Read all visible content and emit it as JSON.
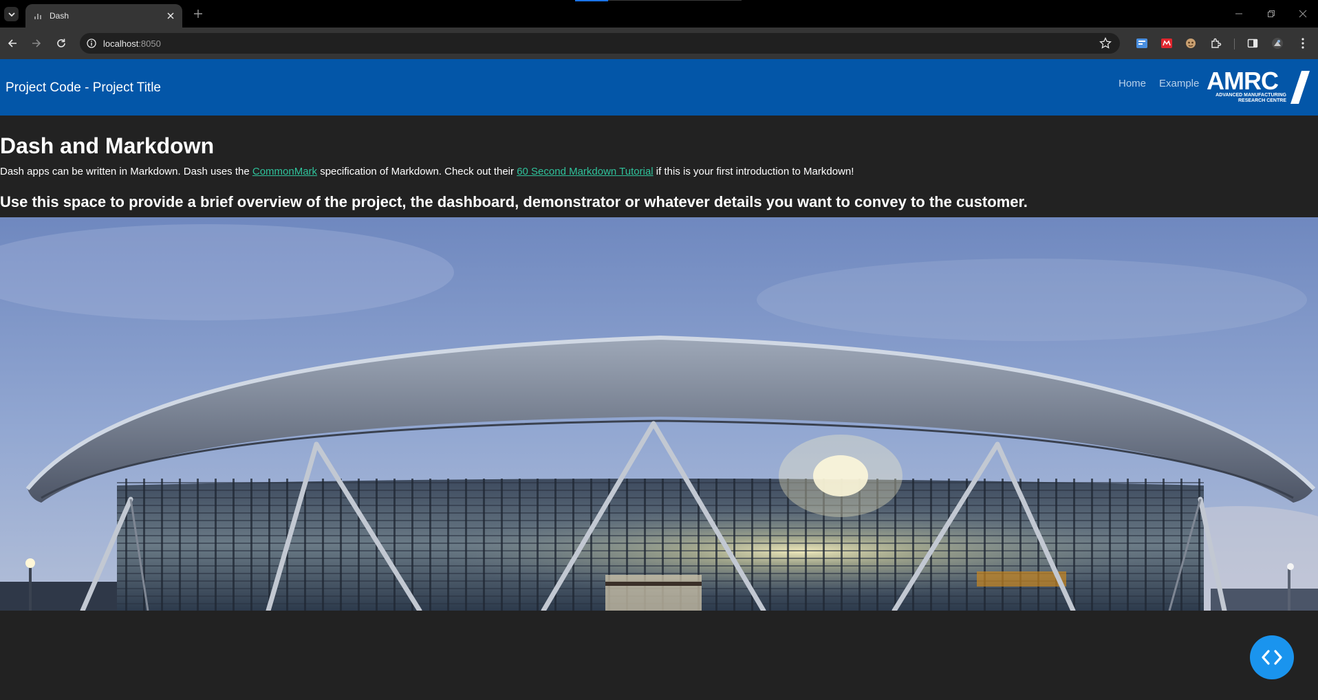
{
  "browser": {
    "tab_title": "Dash",
    "url_host": "localhost",
    "url_port": ":8050"
  },
  "app": {
    "brand": "Project Code - Project Title",
    "nav": [
      {
        "label": "Home"
      },
      {
        "label": "Example"
      }
    ],
    "logo": {
      "name": "AMRC",
      "line1": "ADVANCED MANUFACTURING",
      "line2": "RESEARCH CENTRE"
    }
  },
  "content": {
    "heading": "Dash and Markdown",
    "para_part1": "Dash apps can be written in Markdown. Dash uses the ",
    "link_commonmark": "CommonMark",
    "para_part2": " specification of Markdown. Check out their ",
    "link_tutorial": "60 Second Markdown Tutorial",
    "para_part3": " if this is your first introduction to Markdown!",
    "subheading": "Use this space to provide a brief overview of the project, the dashboard, demonstrator or whatever details you want to convey to the customer."
  },
  "colors": {
    "navbar": "#0356a8",
    "background": "#222222",
    "link": "#2fc19a",
    "fab": "#1a94ee"
  },
  "icons": {
    "fab": "code-brackets-icon"
  }
}
